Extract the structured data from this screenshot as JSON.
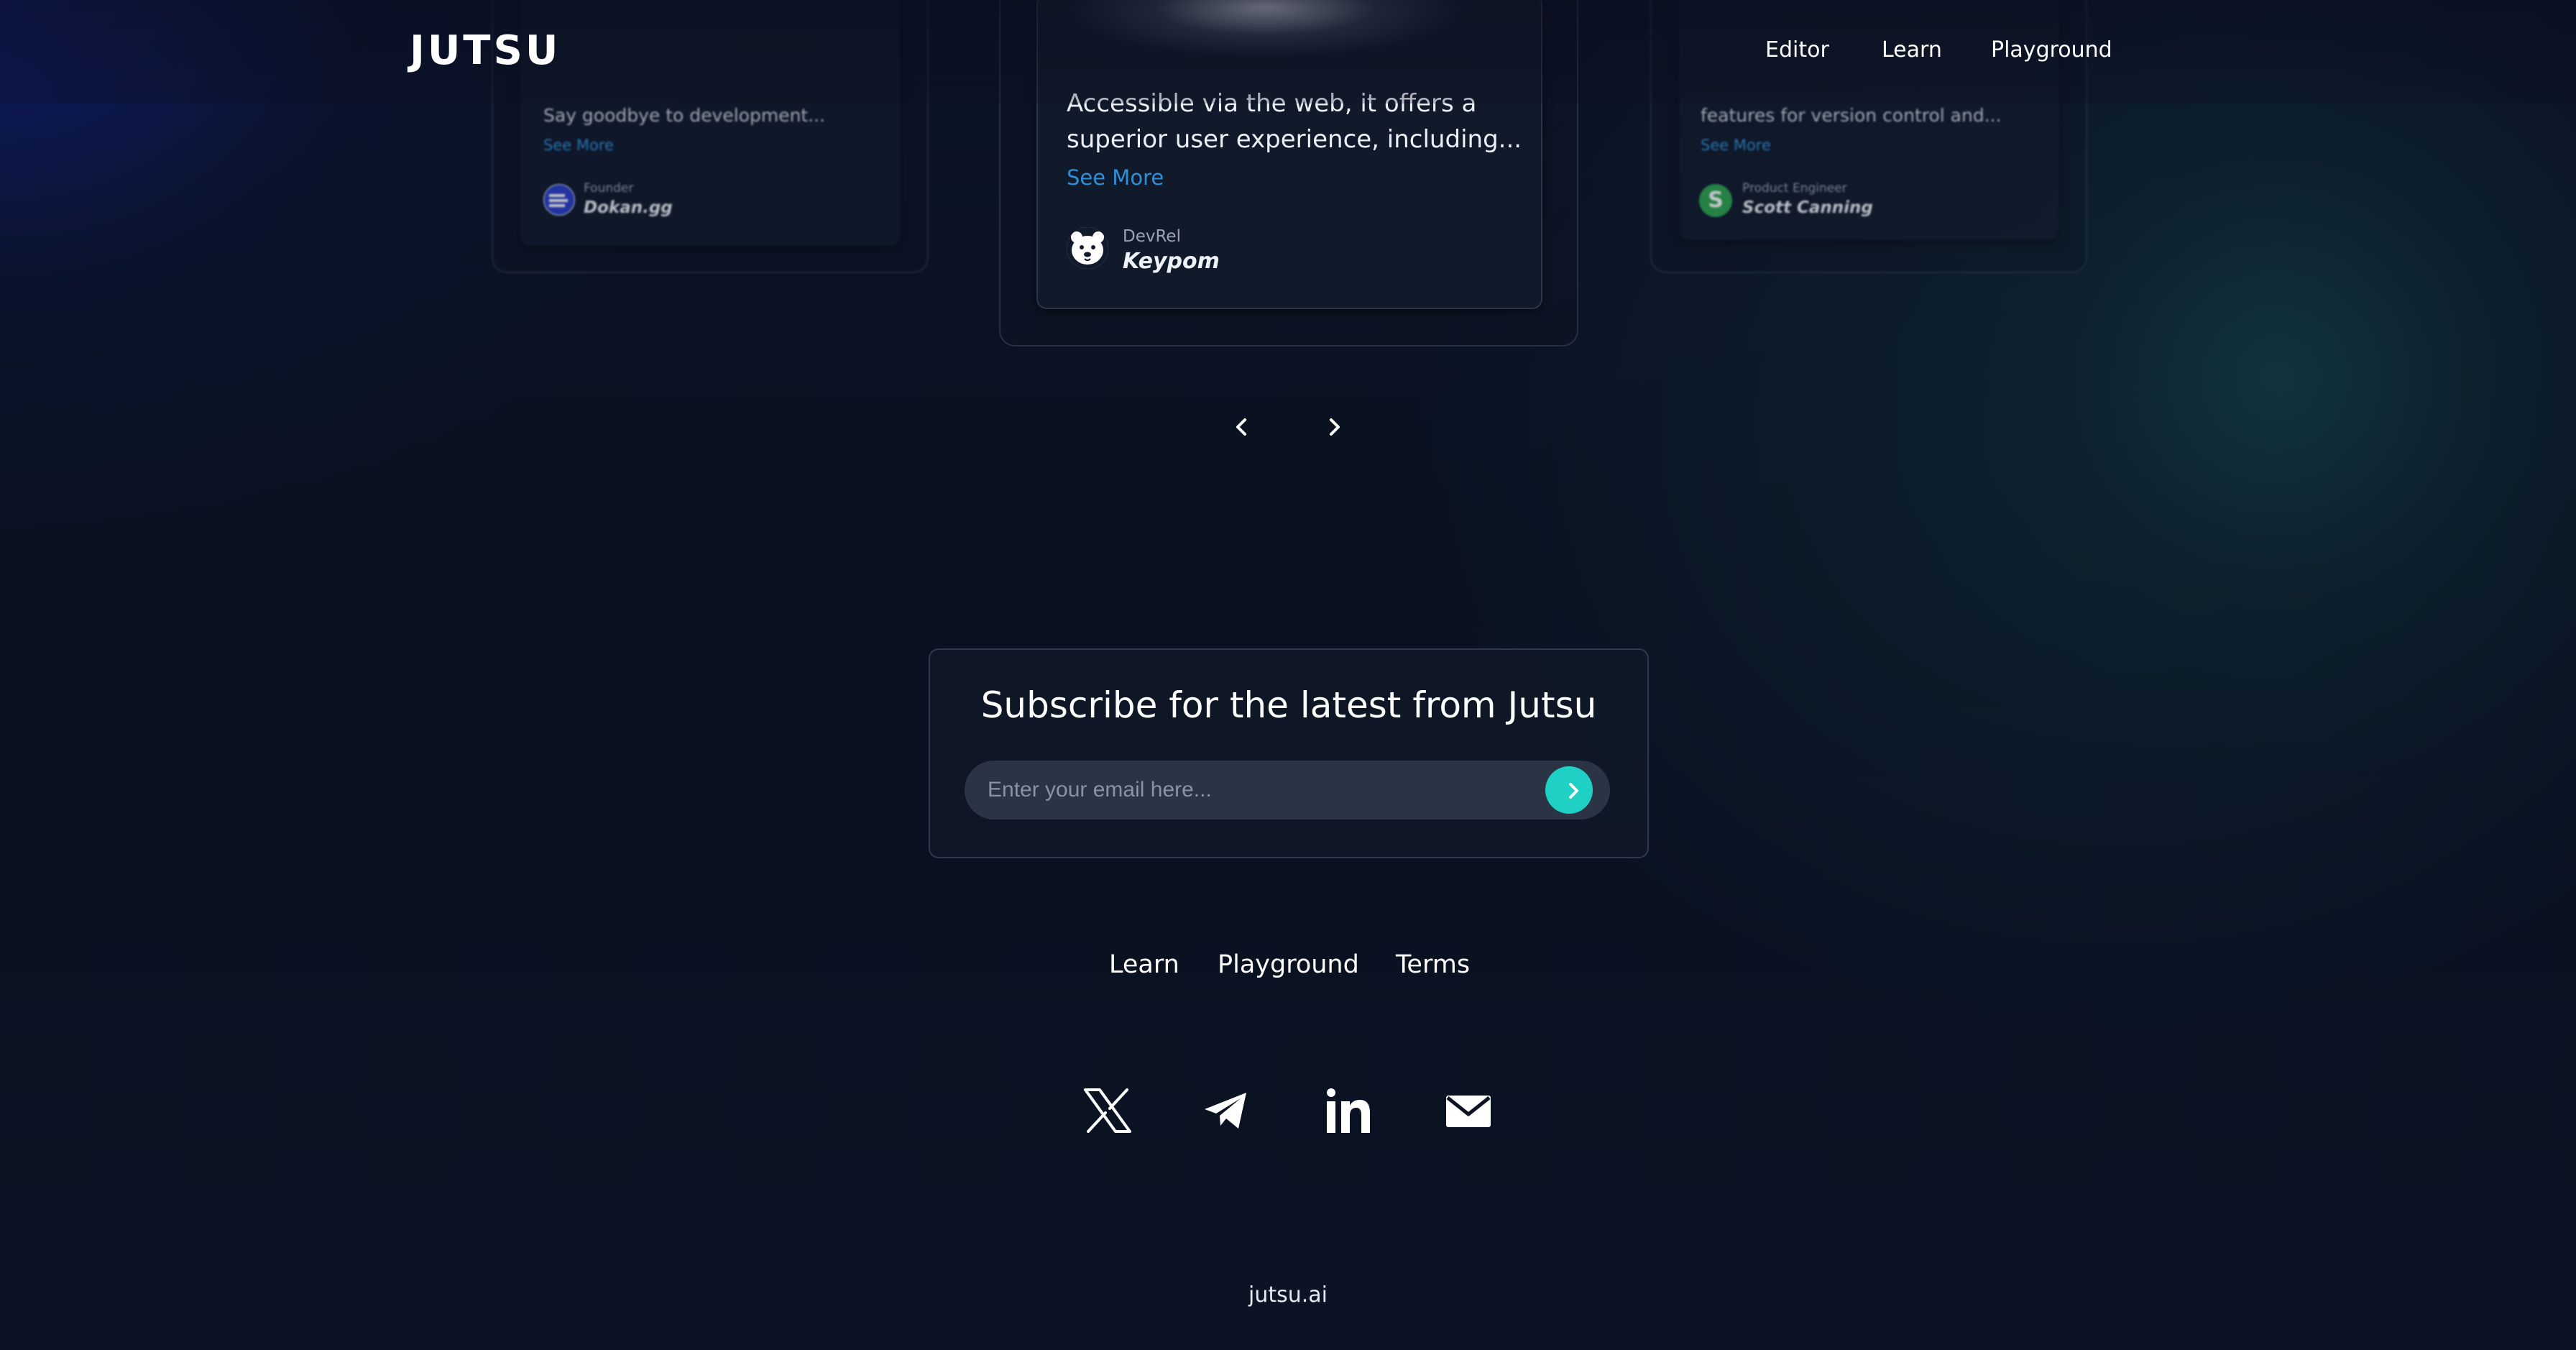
{
  "header": {
    "logo": "JUTSU",
    "nav": [
      "Editor",
      "Learn",
      "Playground"
    ]
  },
  "testimonials": {
    "left": {
      "text": "Say goodbye to development...",
      "see_more": "See More",
      "role": "Founder",
      "author": "Dokan.gg"
    },
    "center": {
      "text_line1": "Accessible via the web, it offers a",
      "text_line2": "superior user experience, including...",
      "see_more": "See More",
      "role": "DevRel",
      "author": "Keypom"
    },
    "right": {
      "text": "features for version control and...",
      "see_more": "See More",
      "role": "Product Engineer",
      "author": "Scott Canning",
      "avatar_letter": "S"
    }
  },
  "subscribe": {
    "title": "Subscribe for the latest from Jutsu",
    "placeholder": "Enter your email here..."
  },
  "footer": {
    "links": [
      "Learn",
      "Playground",
      "Terms"
    ],
    "social": [
      "x-icon",
      "telegram-icon",
      "linkedin-icon",
      "mail-icon"
    ],
    "domain": "jutsu.ai"
  },
  "colors": {
    "accent": "#1fd1c5",
    "link": "#2f8fd6",
    "background": "#0b1324"
  }
}
